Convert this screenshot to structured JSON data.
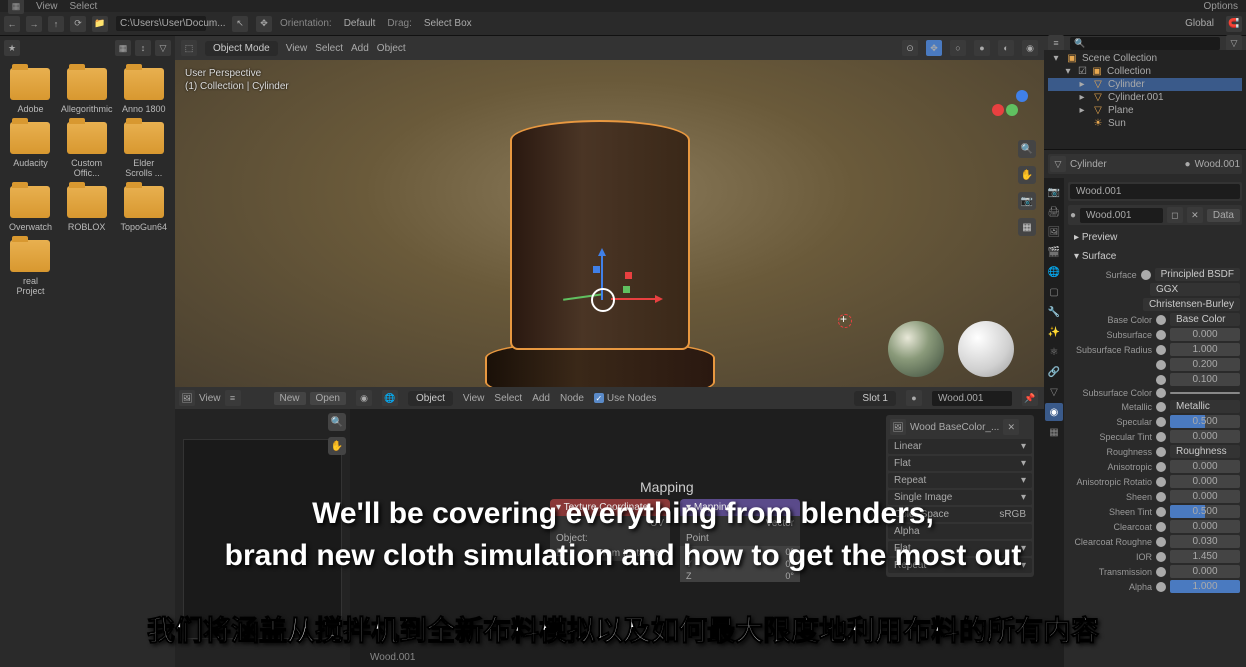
{
  "top_menu": {
    "view": "View",
    "select": "Select",
    "options": "Options"
  },
  "toolbar": {
    "orientation_label": "Orientation:",
    "default": "Default",
    "drag_label": "Drag:",
    "select_box": "Select Box",
    "global": "Global"
  },
  "file_browser": {
    "path": "C:\\Users\\User\\Docum...",
    "folders": [
      "Adobe",
      "Allegorithmic",
      "Anno 1800",
      "Audacity",
      "Custom Offic...",
      "Elder Scrolls ...",
      "Overwatch",
      "ROBLOX",
      "TopoGun64",
      "real Project"
    ]
  },
  "viewport_header": {
    "mode": "Object Mode",
    "view": "View",
    "select": "Select",
    "add": "Add",
    "object": "Object"
  },
  "viewport_info": {
    "line1": "User Perspective",
    "line2": "(1) Collection | Cylinder"
  },
  "uv_editor": {
    "view": "View",
    "new": "New",
    "open": "Open"
  },
  "node_editor": {
    "object": "Object",
    "view": "View",
    "select": "Select",
    "add": "Add",
    "node": "Node",
    "use_nodes": "Use Nodes",
    "slot": "Slot 1",
    "material": "Wood.001",
    "breadcrumb": "Mapping",
    "tex_coord_node": "Texture Coordinate",
    "mapping_node": "Mapping",
    "uv": "UV",
    "object_in": "Object:",
    "from_instancer": "From Instancer",
    "vector": "Vector",
    "point": "Point",
    "footer": "Wood.001"
  },
  "node_params": {
    "x": "X",
    "y": "Y",
    "z": "Z",
    "zero_deg": "0°"
  },
  "image_panel": {
    "name": "Wood BaseColor_...",
    "interp": "Linear",
    "proj": "Flat",
    "ext": "Repeat",
    "source": "Single Image",
    "cs_label": "Color Space",
    "cs": "sRGB",
    "alpha": "Alpha",
    "flat2": "Flat",
    "repeat2": "Repeat"
  },
  "outliner": {
    "scene_collection": "Scene Collection",
    "collection": "Collection",
    "items": [
      "Cylinder",
      "Cylinder.001",
      "Plane",
      "Sun"
    ]
  },
  "properties": {
    "obj_name": "Cylinder",
    "mat_label": "Wood.001",
    "mat_field": "Wood.001",
    "mat_field2": "Wood.001",
    "data_btn": "Data",
    "preview": "Preview",
    "surface_section": "Surface",
    "surface_label": "Surface",
    "surface_value": "Principled BSDF",
    "ggx": "GGX",
    "burley": "Christensen-Burley",
    "rows": [
      {
        "label": "Base Color",
        "value": "Base Color",
        "type": "link"
      },
      {
        "label": "Subsurface",
        "value": "0.000"
      },
      {
        "label": "Subsurface Radius",
        "value": "1.000"
      },
      {
        "label": "",
        "value": "0.200"
      },
      {
        "label": "",
        "value": "0.100"
      },
      {
        "label": "Subsurface Color",
        "value": "",
        "type": "color"
      },
      {
        "label": "Metallic",
        "value": "Metallic",
        "type": "link"
      },
      {
        "label": "Specular",
        "value": "0.500",
        "type": "blue"
      },
      {
        "label": "Specular Tint",
        "value": "0.000"
      },
      {
        "label": "Roughness",
        "value": "Roughness",
        "type": "link"
      },
      {
        "label": "Anisotropic",
        "value": "0.000"
      },
      {
        "label": "Anisotropic Rotatio",
        "value": "0.000"
      },
      {
        "label": "Sheen",
        "value": "0.000"
      },
      {
        "label": "Sheen Tint",
        "value": "0.500",
        "type": "blue"
      },
      {
        "label": "Clearcoat",
        "value": "0.000"
      },
      {
        "label": "Clearcoat Roughne",
        "value": "0.030"
      },
      {
        "label": "IOR",
        "value": "1.450"
      },
      {
        "label": "Transmission",
        "value": "0.000"
      },
      {
        "label": "Alpha",
        "value": "1.000",
        "type": "blue-full"
      }
    ]
  },
  "subtitles": {
    "en1": "We'll be covering everything from blenders,",
    "en2": "brand new cloth simulation and how to get the most out",
    "cn": "我们将涵盖从搅拌机到全新布料模拟以及如何最大限度地利用布料的所有内容"
  }
}
